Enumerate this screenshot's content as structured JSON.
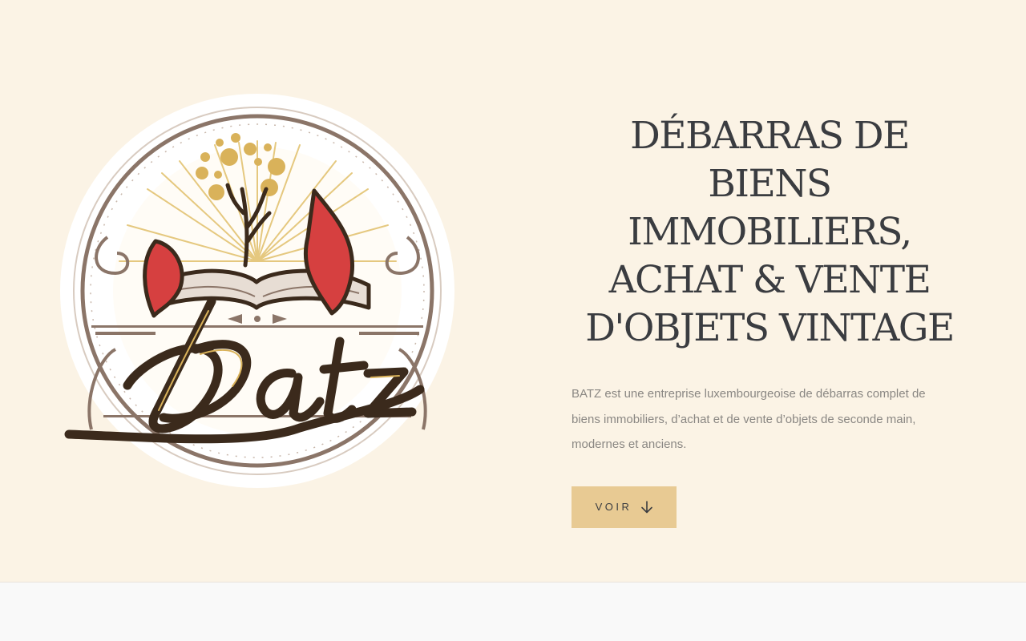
{
  "logo": {
    "brand": "Batz",
    "icon": "batz-logo-icon"
  },
  "hero": {
    "headline": "DÉBARRAS DE BIENS IMMOBILIERS, ACHAT & VENTE D'OBJETS VINTAGE",
    "intro": "BATZ est une entreprise luxembourgeoise de débarras complet de biens immobiliers, d’achat et de vente d’objets de seconde main, modernes et anciens.",
    "cta_label": "VOIR",
    "cta_icon": "arrow-down-icon"
  },
  "colors": {
    "page_bg": "#fbf3e5",
    "button_bg": "#e8ca93",
    "heading": "#3a3c40",
    "body_text": "#8a8783",
    "logo_brown": "#3b2a1c",
    "logo_red": "#d64040",
    "logo_gold": "#d9b25a"
  }
}
